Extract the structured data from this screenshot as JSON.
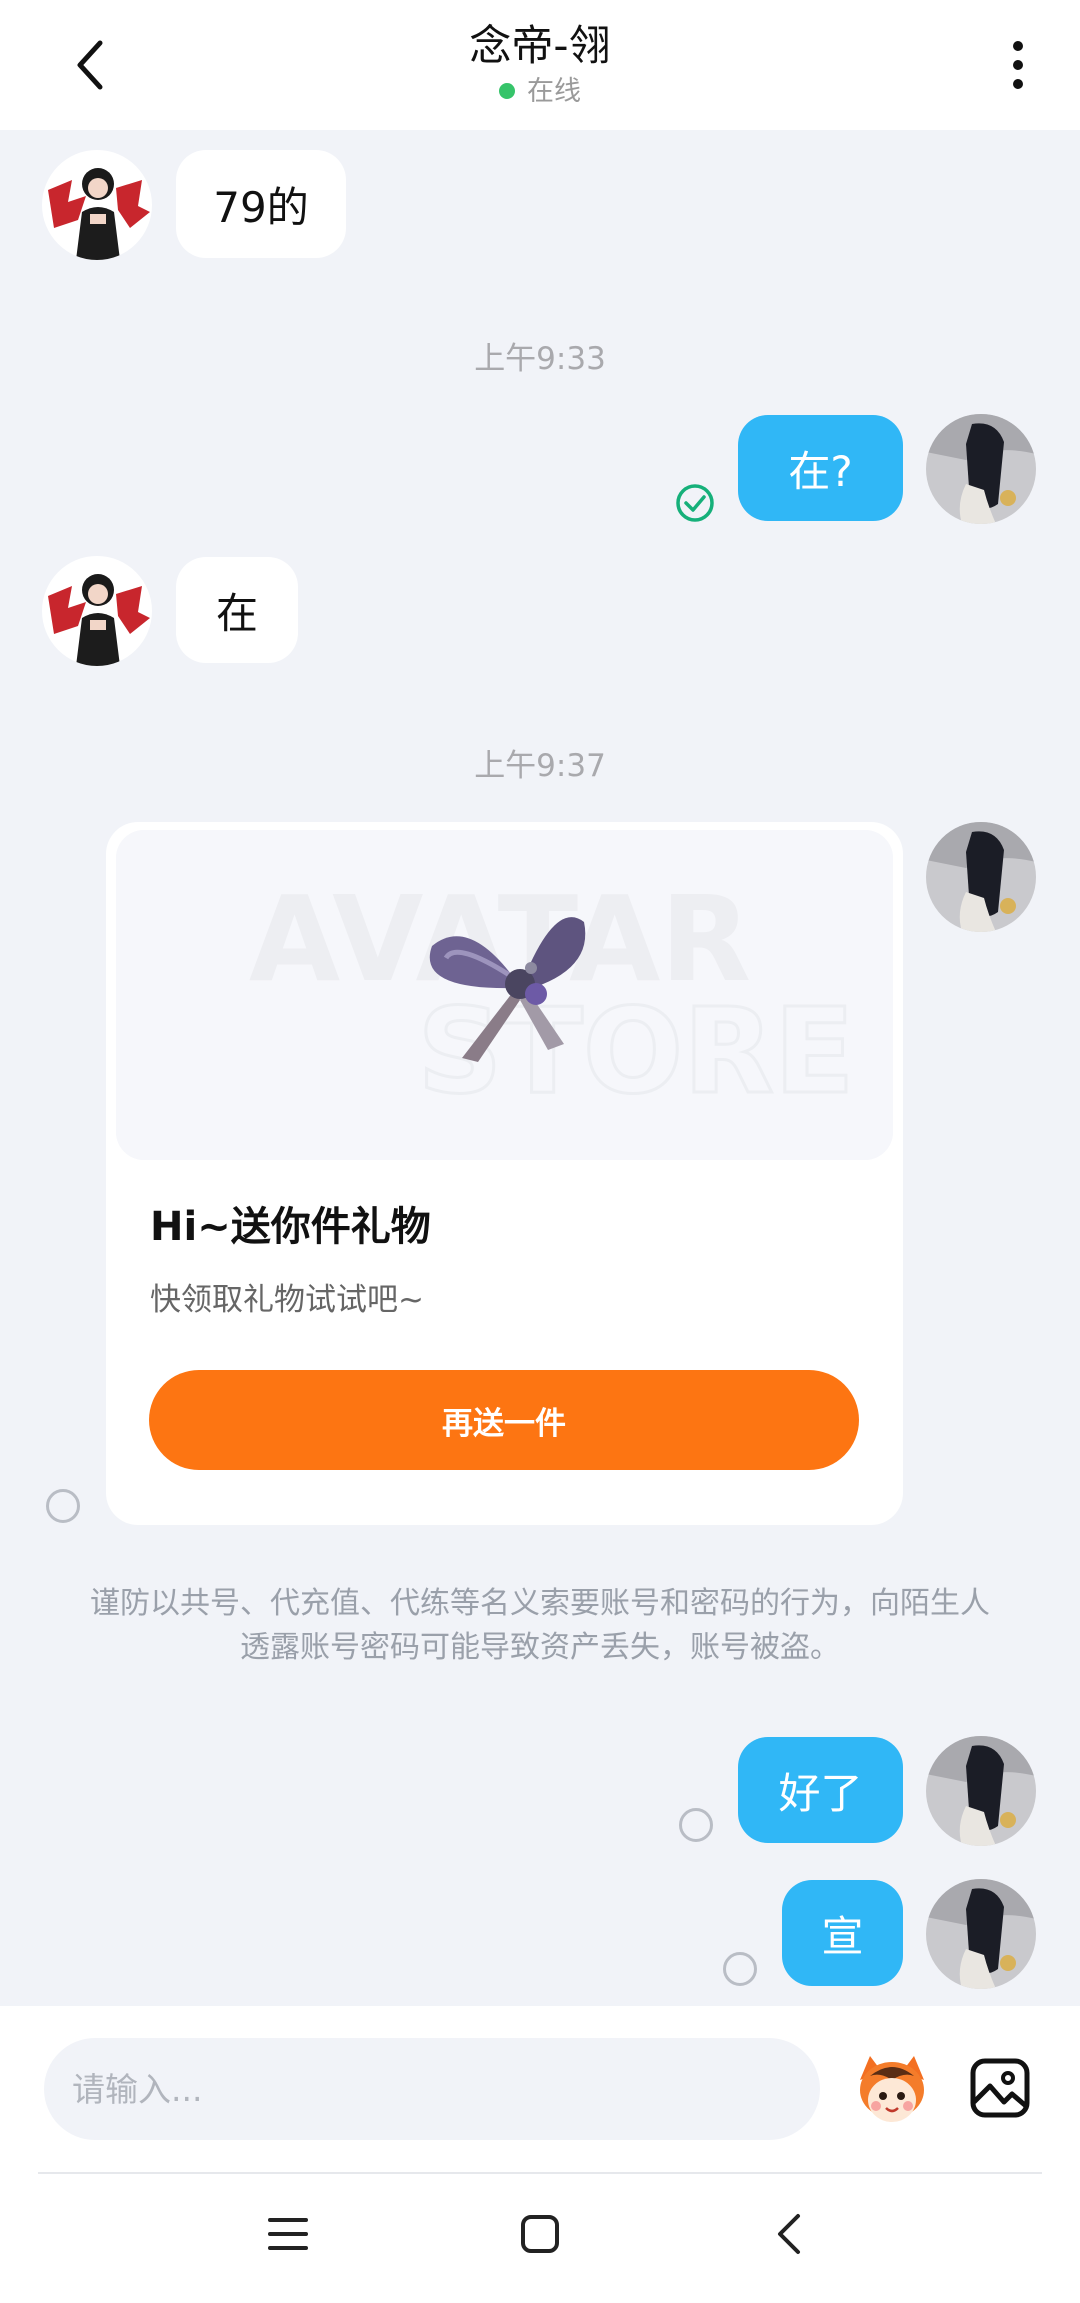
{
  "header": {
    "title": "念帝-翎",
    "status": "在线"
  },
  "messages": {
    "m1_text": "79的",
    "time1": "上午9:33",
    "m2_text": "在?",
    "m3_text": "在",
    "time2": "上午9:37",
    "gift": {
      "title": "Hi~送你件礼物",
      "subtitle": "快领取礼物试试吧~",
      "button": "再送一件",
      "watermark_line1": "AVATAR",
      "watermark_line2": "STORE"
    },
    "warning": "谨防以共号、代充值、代练等名义索要账号和密码的行为，向陌生人透露账号密码可能导致资产丢失，账号被盗。",
    "m4_text": "好了",
    "m5_text": "宣"
  },
  "input": {
    "placeholder": "请输入..."
  },
  "colors": {
    "accent_blue": "#30b7f6",
    "gift_button": "#fd7512",
    "online_dot": "#36c46a",
    "read_check": "#16b07a"
  },
  "icons": [
    "back-arrow-icon",
    "more-vertical-icon",
    "read-check-icon",
    "emoji-mascot-icon",
    "image-icon",
    "menu-icon",
    "home-square-icon",
    "nav-back-icon"
  ]
}
